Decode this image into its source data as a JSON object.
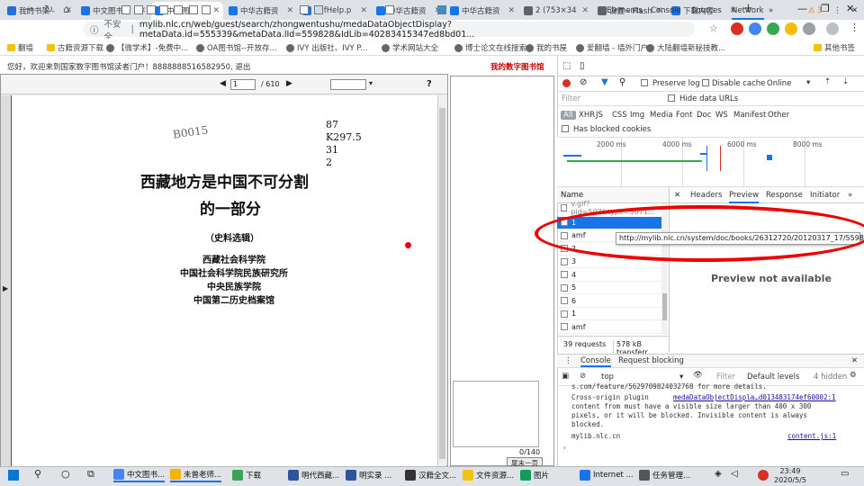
{
  "tabs": [
    {
      "label": "我的书架 - ",
      "color": "#1a73e8"
    },
    {
      "label": "中文图书 - ",
      "color": "#1a73e8"
    },
    {
      "label": "中文图书",
      "color": "#1a73e8",
      "active": true
    },
    {
      "label": "中华古籍资",
      "color": "#1a73e8"
    },
    {
      "label": "pdfHelp.p",
      "color": "#1a73e8"
    },
    {
      "label": "中华古籍资",
      "color": "#1a73e8"
    },
    {
      "label": "中华古籍资",
      "color": "#1a73e8"
    },
    {
      "label": "2 (753×34",
      "color": "#5f6368"
    },
    {
      "label": "设置 - Flash",
      "color": "#5f6368"
    },
    {
      "label": "下载内容",
      "color": "#1a73e8"
    }
  ],
  "omnibox": {
    "security": "不安全",
    "url": "mylib.nlc.cn/web/guest/search/zhongwentushu/medaDataObjectDisplay?metaData.id=555339&metaData.lId=559828&IdLib=40283415347ed8bd01..."
  },
  "bookmarks": [
    "翻墙",
    "古籍资源下载",
    "【微学术】-免费中...",
    "OA图书馆--开放存...",
    "IVY 出版社、IVY P...",
    "学术网站大全",
    "博士论文在线搜索...",
    "我的书屋",
    "爱翻墙 - 墙外门户",
    "大陆翻墙新秘技教...",
    "其他书签"
  ],
  "page": {
    "welcome": "您好，欢迎来到国家数字图书馆读者门户！8888888516582950, 退出",
    "mylib": "我的数字图书馆"
  },
  "viewer": {
    "page_value": "1",
    "page_total": "/ 610",
    "thumb_count": "0/140",
    "last_page": "尾末一页"
  },
  "doc": {
    "handwriting": "B0015",
    "catalog": [
      "87",
      "K297.5",
      "31",
      "2"
    ],
    "title1": "西藏地方是中国不可分割",
    "title2": "的一部分",
    "subtitle": "（史料选辑）",
    "authors": [
      "西藏社会科学院",
      "中国社会科学院民族研究所",
      "中央民族学院",
      "中国第二历史档案馆"
    ]
  },
  "devtools": {
    "tabs": [
      "Elements",
      "Console",
      "Sources",
      "Network"
    ],
    "warnings": "3",
    "net": {
      "preserve_log": "Preserve log",
      "disable_cache": "Disable cache",
      "throttle": "Online"
    },
    "filter": {
      "placeholder": "Filter",
      "hide_data_urls": "Hide data URLs"
    },
    "types": [
      "All",
      "XHR",
      "JS",
      "CSS",
      "Img",
      "Media",
      "Font",
      "Doc",
      "WS",
      "Manifest",
      "Other"
    ],
    "blocked_cookies": "Has blocked cookies",
    "ticks": [
      "2000 ms",
      "4000 ms",
      "6000 ms",
      "8000 ms"
    ],
    "name_header": "Name",
    "requests": [
      "v.gif?pid=507&type=3071...",
      "1",
      "amf",
      "2",
      "3",
      "4",
      "5",
      "6",
      "1",
      "amf"
    ],
    "summary_requests": "39 requests",
    "summary_transfer": "578 kB transferr",
    "detail_tabs": [
      "Headers",
      "Preview",
      "Response",
      "Initiator"
    ],
    "preview_na": "Preview not available",
    "tooltip": "http://mylib.nlc.cn/system/doc/books/26312720/20120317_17/559828/1",
    "console_tabs": [
      "Console",
      "Request blocking"
    ],
    "console_context": "top",
    "console_filter": "Filter",
    "levels": "Default levels",
    "hidden": "4 hidden",
    "console_lines": [
      "s.com/feature/5629709824032768 for more details.",
      "Cross-origin plugin",
      "content from  must have a visible size larger than 400 x 300",
      "pixels, or it will be blocked. Invisible content is always",
      "blocked.",
      "mylib.nlc.cn"
    ],
    "console_links": [
      "medaDataObjectDispla…d013483174ef60002:1",
      "content.js:1"
    ]
  },
  "taskbar": {
    "items": [
      "中文图书...",
      "未曾老师...",
      "下载",
      "明代西藏...",
      "明实录 ...",
      "汉籍全文...",
      "文件资源...",
      "图片",
      "Internet ...",
      "任务管理..."
    ],
    "time": "23:49",
    "date": "2020/5/5"
  }
}
